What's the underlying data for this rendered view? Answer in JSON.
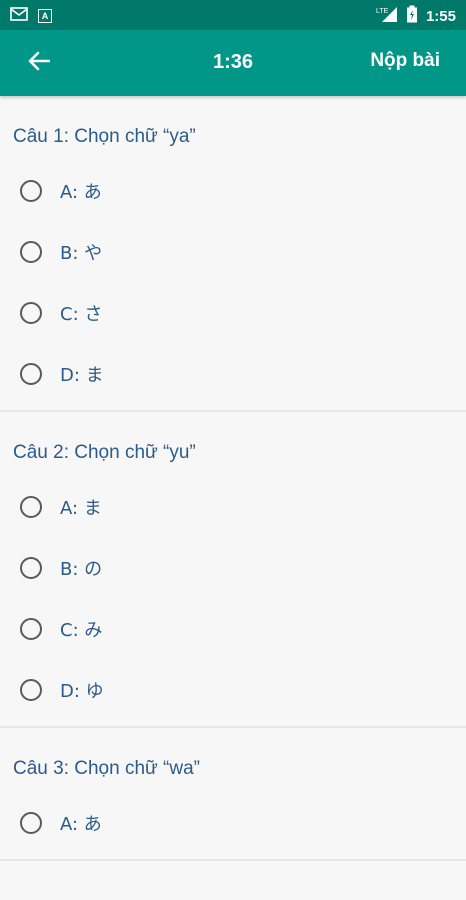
{
  "status_bar": {
    "time": "1:55",
    "icons": [
      "gmail-icon",
      "a-notification-icon",
      "lte-signal-icon",
      "battery-icon"
    ]
  },
  "app_bar": {
    "back_icon": "arrow-left-icon",
    "timer": "1:36",
    "submit_label": "Nộp bài"
  },
  "colors": {
    "status_bar": "#00796b",
    "app_bar": "#009688",
    "text_blue": "#2b5b8a",
    "background": "#f7f7f7"
  },
  "questions": [
    {
      "title": "Câu 1: Chọn chữ  “ya”",
      "options": [
        "A: あ",
        "B: や",
        "C: さ",
        "D: ま"
      ]
    },
    {
      "title": "Câu 2: Chọn chữ  “yu”",
      "options": [
        "A: ま",
        "B: の",
        "C: み",
        "D: ゆ"
      ]
    },
    {
      "title": "Câu 3: Chọn chữ  “wa”",
      "options": [
        "A: あ"
      ]
    }
  ]
}
